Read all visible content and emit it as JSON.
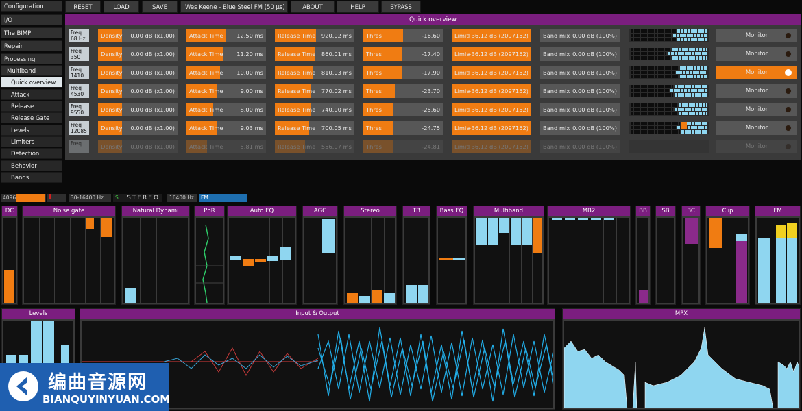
{
  "sidebar": {
    "items": [
      "Configuration",
      "I/O",
      "The BIMP",
      "Repair",
      "Processing",
      "Multiband",
      "Quick overview",
      "Attack",
      "Release",
      "Release Gate",
      "Levels",
      "Limiters",
      "Detection",
      "Behavior",
      "Bands"
    ]
  },
  "toolbar": {
    "reset": "RESET",
    "load": "LOAD",
    "save": "SAVE",
    "preset": "Wes Keene - Blue Steel FM (50 µs)",
    "about": "ABOUT",
    "help": "HELP",
    "bypass": "BYPASS"
  },
  "quick_overview": {
    "title": "Quick overview",
    "labels": {
      "density": "Density",
      "attack": "Attack Time",
      "release": "Release Time",
      "thres": "Thres",
      "limit": "Limit",
      "bandmix": "Band mix",
      "monitor": "Monitor"
    },
    "bands": [
      {
        "freq_label": "Freq",
        "freq": "68 Hz",
        "density": "0.00 dB (x1.00)",
        "density_fill": 0.3,
        "attack": "12.50 ms",
        "attack_fill": 0.5,
        "release": "920.02 ms",
        "release_fill": 0.52,
        "thres": "-16.60",
        "thres_fill": 0.5,
        "limit": "+36.12 dB (2097152)",
        "limit_fill": 1.0,
        "bandmix": "0.00 dB (100%)",
        "bandmix_fill": 0.0,
        "monitor_on": false
      },
      {
        "freq_label": "Freq",
        "freq": "350",
        "density": "0.00 dB (x1.00)",
        "density_fill": 0.3,
        "attack": "11.20 ms",
        "attack_fill": 0.46,
        "release": "860.01 ms",
        "release_fill": 0.5,
        "thres": "-17.40",
        "thres_fill": 0.49,
        "limit": "+36.12 dB (2097152)",
        "limit_fill": 1.0,
        "bandmix": "0.00 dB (100%)",
        "bandmix_fill": 0.0,
        "monitor_on": false
      },
      {
        "freq_label": "Freq",
        "freq": "1410",
        "density": "0.00 dB (x1.00)",
        "density_fill": 0.3,
        "attack": "10.00 ms",
        "attack_fill": 0.42,
        "release": "810.03 ms",
        "release_fill": 0.48,
        "thres": "-17.90",
        "thres_fill": 0.48,
        "limit": "+36.12 dB (2097152)",
        "limit_fill": 1.0,
        "bandmix": "0.00 dB (100%)",
        "bandmix_fill": 0.0,
        "monitor_on": true
      },
      {
        "freq_label": "Freq",
        "freq": "4530",
        "density": "0.00 dB (x1.00)",
        "density_fill": 0.3,
        "attack": "9.00 ms",
        "attack_fill": 0.38,
        "release": "770.02 ms",
        "release_fill": 0.46,
        "thres": "-23.70",
        "thres_fill": 0.4,
        "limit": "+36.12 dB (2097152)",
        "limit_fill": 1.0,
        "bandmix": "0.00 dB (100%)",
        "bandmix_fill": 0.0,
        "monitor_on": false
      },
      {
        "freq_label": "Freq",
        "freq": "9550",
        "density": "0.00 dB (x1.00)",
        "density_fill": 0.3,
        "attack": "8.00 ms",
        "attack_fill": 0.34,
        "release": "740.00 ms",
        "release_fill": 0.45,
        "thres": "-25.60",
        "thres_fill": 0.37,
        "limit": "+36.12 dB (2097152)",
        "limit_fill": 1.0,
        "bandmix": "0.00 dB (100%)",
        "bandmix_fill": 0.0,
        "monitor_on": false
      },
      {
        "freq_label": "Freq",
        "freq": "12085",
        "density": "0.00 dB (x1.00)",
        "density_fill": 0.3,
        "attack": "9.03 ms",
        "attack_fill": 0.38,
        "release": "700.05 ms",
        "release_fill": 0.43,
        "thres": "-24.75",
        "thres_fill": 0.38,
        "limit": "+36.12 dB (2097152)",
        "limit_fill": 1.0,
        "bandmix": "0.00 dB (100%)",
        "bandmix_fill": 0.0,
        "monitor_on": false
      },
      {
        "freq_label": "Freq",
        "freq": "",
        "density": "0.00 dB (x1.00)",
        "density_fill": 0.3,
        "attack": "5.81 ms",
        "attack_fill": 0.26,
        "release": "556.07 ms",
        "release_fill": 0.38,
        "thres": "-24.81",
        "thres_fill": 0.38,
        "limit": "+36.12 dB (2097152)",
        "limit_fill": 1.0,
        "bandmix": "0.00 dB (100%)",
        "bandmix_fill": 0.0,
        "monitor_on": false
      }
    ]
  },
  "status": {
    "fft": "4096",
    "range": "30-16400 Hz",
    "stereo_prefix": "S",
    "stereo": "STEREO",
    "bw": "16400 Hz",
    "mode": "FM"
  },
  "panels": {
    "dc": "DC",
    "noise_gate": "Noise gate",
    "natural_dynamics": "Natural Dynami",
    "phr": "PhR",
    "auto_eq": "Auto EQ",
    "agc": "AGC",
    "stereo": "Stereo",
    "tb": "TB",
    "bass_eq": "Bass EQ",
    "multiband": "Multiband",
    "mb2": "MB2",
    "bb": "BB",
    "sb": "SB",
    "bc": "BC",
    "clip": "Clip",
    "fm": "FM",
    "levels": "Levels",
    "io": "Input & Output",
    "mpx": "MPX"
  },
  "watermark": {
    "big": "编曲音源网",
    "small": "BIANQUYINYUAN.COM"
  },
  "colors": {
    "accent": "#f07c12",
    "header": "#7b1e7f",
    "meter": "#8fd6f0",
    "panel": "#3a3a3a"
  }
}
